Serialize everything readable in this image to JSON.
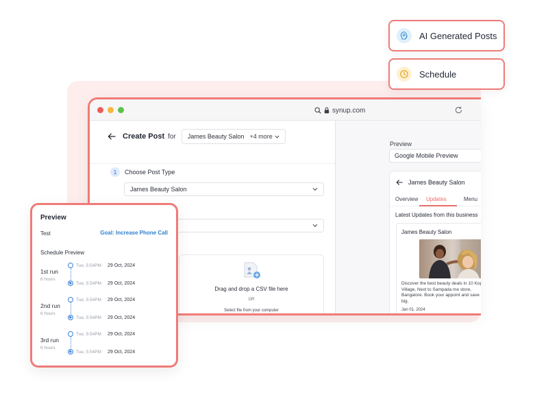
{
  "pills": {
    "ai_generated": "AI Generated Posts",
    "schedule": "Schedule"
  },
  "browser": {
    "url": "synup.com"
  },
  "create_post": {
    "title": "Create Post",
    "for_label": "for",
    "account": "James Beauty Salon",
    "more": "+4 more",
    "step_number": "1",
    "step_label": "Choose Post Type",
    "post_type_value": "James Beauty Salon",
    "second_select_value": "",
    "upload_main": "Drag and drop a CSV file here",
    "upload_or": "OR",
    "upload_sub": "Select file from your computer"
  },
  "preview_pane": {
    "label": "Preview",
    "select_value": "Google Mobile Preview",
    "business_name": "James Beauty Salon",
    "tabs": [
      "Overview",
      "Updates",
      "Menu"
    ],
    "active_tab": "Updates",
    "updates_heading": "Latest Updates from this business",
    "card_title": "James Beauty Salon",
    "card_description": "Discover the best beauty deals in 10 Koppa Village, Next to Sampada me store, Bangalore. Book your appoint and save big.",
    "card_date": "Jan 01, 2024"
  },
  "preview_card": {
    "title": "Preview",
    "test_label": "Test",
    "goal": "Goal: Increase Phone Call",
    "schedule_label": "Schedule Preview",
    "runs": [
      {
        "name": "1st run",
        "hours": "6 hours",
        "start_time": "Tue, 5:54PM",
        "start_date": "29 Oct, 2024",
        "end_time": "Tue, 5:54PM",
        "end_date": "29 Oct, 2024"
      },
      {
        "name": "2nd run",
        "hours": "6 hours",
        "start_time": "Tue, 5:54PM",
        "start_date": "29 Oct, 2024",
        "end_time": "Tue, 5:54PM",
        "end_date": "29 Oct, 2024"
      },
      {
        "name": "3rd run",
        "hours": "6 hours",
        "start_time": "Tue, 5:54PM",
        "start_date": "29 Oct, 2024",
        "end_time": "Tue, 5:54PM",
        "end_date": "29 Oct, 2024"
      }
    ]
  },
  "icons": {
    "ai": "ai-brain-icon",
    "schedule": "clock-icon",
    "back": "arrow-left-icon",
    "search": "search-icon",
    "lock": "lock-icon",
    "reload": "reload-icon",
    "chevron": "chevron-down-icon",
    "upload": "csv-upload-icon"
  },
  "colors": {
    "accent_border": "#ef7a78",
    "backdrop": "#fdeeed",
    "link_blue": "#2e7fd0",
    "active_tab": "#e46d69",
    "ai_icon_bg": "#dff0fb",
    "clock_icon_bg": "#fdf1d3"
  }
}
